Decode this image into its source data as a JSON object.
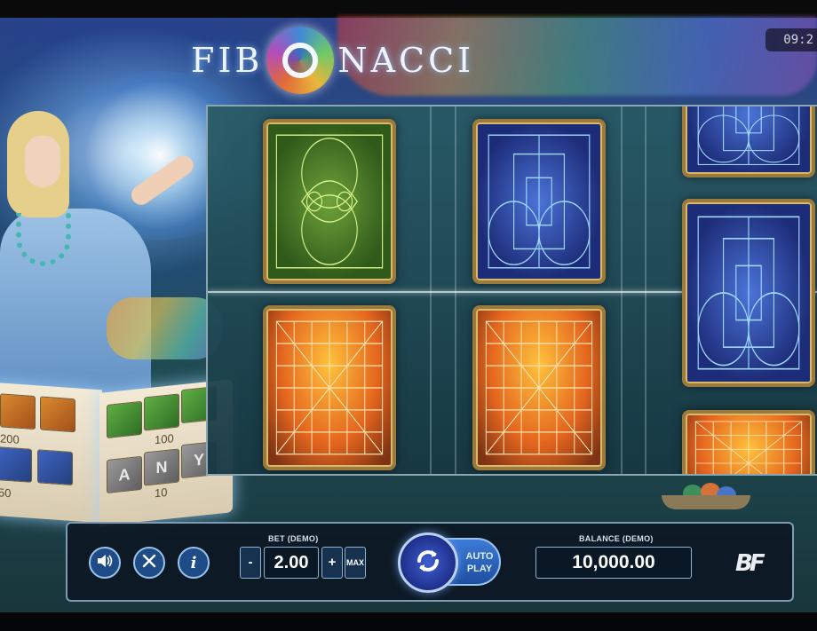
{
  "game": {
    "title_left": "FIB",
    "title_right": "NACCI"
  },
  "clock": "09:2",
  "book": {
    "left_value": "200",
    "left_value_2": "50",
    "right_value": "100",
    "right_value_2": "10",
    "letters": [
      "A",
      "N",
      "Y"
    ]
  },
  "reels": [
    [
      "green",
      "orange"
    ],
    [
      "blue",
      "orange"
    ],
    [
      "blue",
      "blue",
      "orange"
    ]
  ],
  "controls": {
    "bet_label": "BET (DEMO)",
    "bet_value": "2.00",
    "minus": "-",
    "plus": "+",
    "max": "MAX",
    "auto_play": "AUTO PLAY",
    "balance_label": "BALANCE (DEMO)",
    "balance_value": "10,000.00",
    "sound_icon": "speaker-icon",
    "settings_icon": "tools-icon",
    "info_icon": "info-icon",
    "info_glyph": "i",
    "brand": "BF"
  },
  "colors": {
    "panel_border": "#7f9cb3",
    "spin_button": "#3f5fd0"
  }
}
